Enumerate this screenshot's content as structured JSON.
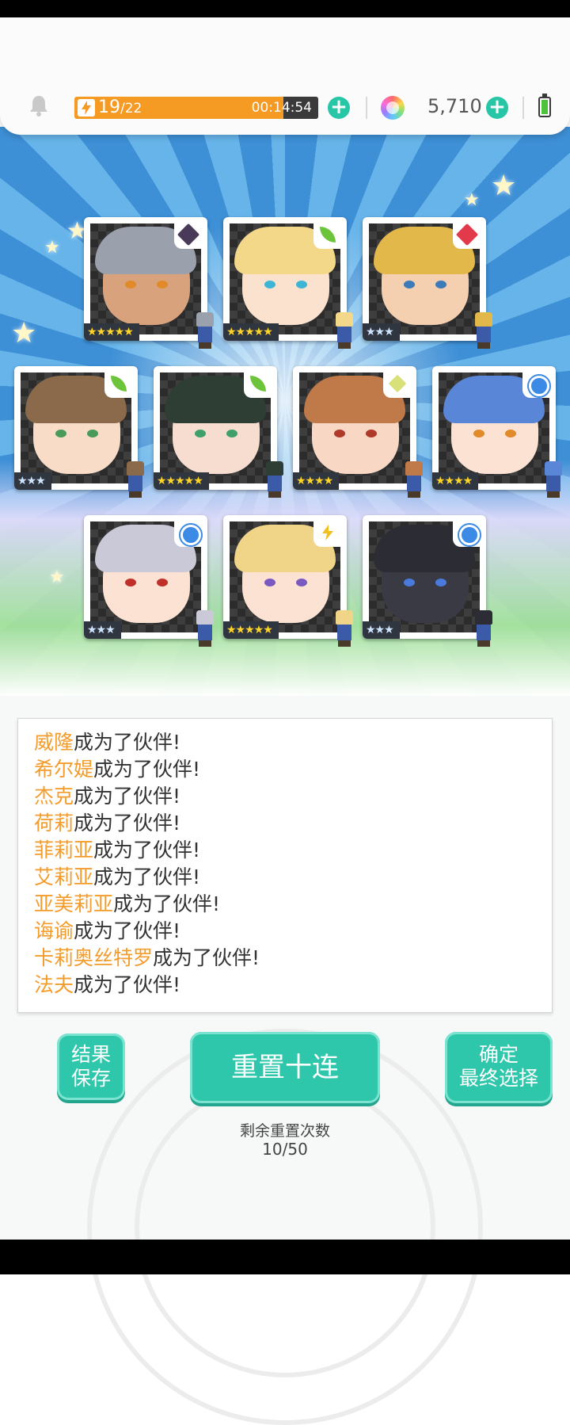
{
  "header": {
    "stamina_current": "19",
    "stamina_max": "/22",
    "stamina_timer": "00:14:54",
    "gems": "5,710"
  },
  "cards": [
    {
      "elem_icon": "dark-icon",
      "elem_color": "#4a3a5a",
      "rarity": "★★★★★",
      "hair": "#9aa1ad",
      "skin": "#d8a27c",
      "eye": "#e08a2a"
    },
    {
      "elem_icon": "wind-icon",
      "elem_color": "#6cc43a",
      "rarity": "★★★★★",
      "hair": "#f3d88a",
      "skin": "#fbe2cf",
      "eye": "#3fb5d6"
    },
    {
      "elem_icon": "fire-icon",
      "elem_color": "#e23a4a",
      "rarity": "★★★",
      "hair": "#e2b84a",
      "skin": "#f4d0b0",
      "eye": "#3d7ab8"
    },
    {
      "elem_icon": "wind-icon",
      "elem_color": "#6cc43a",
      "rarity": "★★★",
      "hair": "#8a6a4a",
      "skin": "#f8dcc8",
      "eye": "#4a9a5a"
    },
    {
      "elem_icon": "wind-icon",
      "elem_color": "#6cc43a",
      "rarity": "★★★★★",
      "hair": "#2e3e34",
      "skin": "#f6ddd0",
      "eye": "#3fa06a"
    },
    {
      "elem_icon": "light-icon",
      "elem_color": "#d8e07a",
      "rarity": "★★★★",
      "hair": "#c07a4a",
      "skin": "#f8d8c4",
      "eye": "#b03a2a"
    },
    {
      "elem_icon": "water-icon",
      "elem_color": "#3b8ae6",
      "rarity": "★★★★",
      "hair": "#5a86d8",
      "skin": "#fbe2d2",
      "eye": "#e08a2a"
    },
    {
      "elem_icon": "water-icon",
      "elem_color": "#3b8ae6",
      "rarity": "★★★",
      "hair": "#c9c9d8",
      "skin": "#fbe2d2",
      "eye": "#c0302a"
    },
    {
      "elem_icon": "thunder-icon",
      "elem_color": "#f0c020",
      "rarity": "★★★★★",
      "hair": "#f0d488",
      "skin": "#fbe2d2",
      "eye": "#7a5ac0"
    },
    {
      "elem_icon": "water-icon",
      "elem_color": "#3b8ae6",
      "rarity": "★★★",
      "hair": "#2c2c34",
      "skin": "#3a3a44",
      "eye": "#4a7adc"
    }
  ],
  "log": [
    {
      "name": "威隆",
      "suffix": "成为了伙伴!"
    },
    {
      "name": "希尔媞",
      "suffix": "成为了伙伴!"
    },
    {
      "name": "杰克",
      "suffix": "成为了伙伴!"
    },
    {
      "name": "荷莉",
      "suffix": "成为了伙伴!"
    },
    {
      "name": "菲莉亚",
      "suffix": "成为了伙伴!"
    },
    {
      "name": "艾莉亚",
      "suffix": "成为了伙伴!"
    },
    {
      "name": "亚美莉亚",
      "suffix": "成为了伙伴!"
    },
    {
      "name": "诲谕",
      "suffix": "成为了伙伴!"
    },
    {
      "name": "卡莉奥丝特罗",
      "suffix": "成为了伙伴!"
    },
    {
      "name": "法夫",
      "suffix": "成为了伙伴!"
    }
  ],
  "buttons": {
    "save_line1": "结果",
    "save_line2": "保存",
    "reset": "重置十连",
    "confirm_line1": "确定",
    "confirm_line2": "最终选择"
  },
  "remaining": {
    "label": "剩余重置次数",
    "value": "10/50"
  }
}
